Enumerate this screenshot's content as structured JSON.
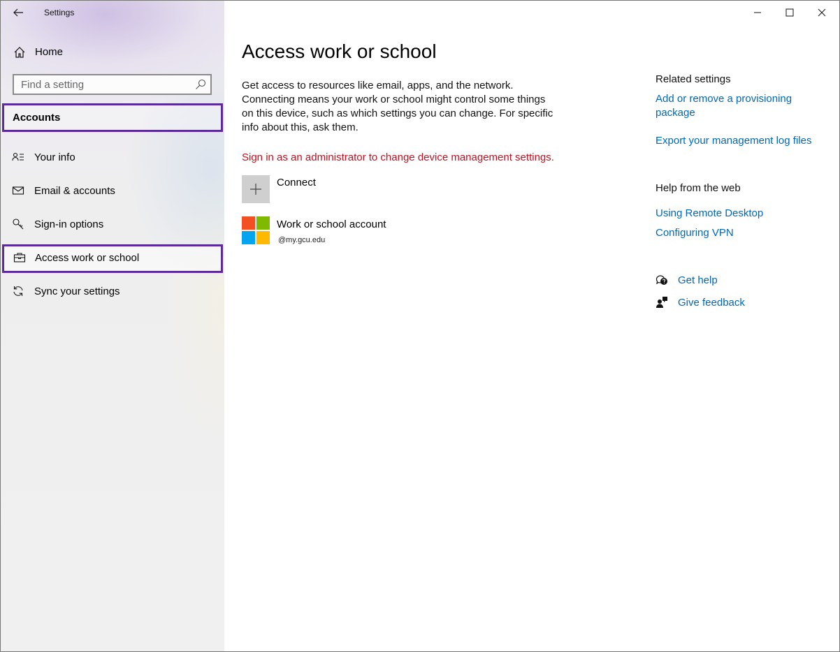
{
  "window": {
    "app_title": "Settings",
    "controls": {
      "minimize": "minimize-icon",
      "maximize": "maximize-icon",
      "close": "close-icon"
    }
  },
  "sidebar": {
    "home_label": "Home",
    "search_placeholder": "Find a setting",
    "section_header": "Accounts",
    "items": [
      {
        "label": "Your info",
        "icon": "person-card-icon"
      },
      {
        "label": "Email & accounts",
        "icon": "mail-icon"
      },
      {
        "label": "Sign-in options",
        "icon": "key-icon"
      },
      {
        "label": "Access work or school",
        "icon": "briefcase-icon",
        "selected": true
      },
      {
        "label": "Sync your settings",
        "icon": "sync-icon"
      }
    ]
  },
  "main": {
    "title": "Access work or school",
    "description": "Get access to resources like email, apps, and the network. Connecting means your work or school might control some things on this device, such as which settings you can change. For specific info about this, ask them.",
    "warning": "Sign in as an administrator to change device management settings.",
    "connect_label": "Connect",
    "account": {
      "name": "Work or school account",
      "email": "@my.gcu.edu"
    }
  },
  "related": {
    "heading": "Related settings",
    "links": [
      "Add or remove a provisioning package",
      "Export your management log files"
    ]
  },
  "help_web": {
    "heading": "Help from the web",
    "links": [
      "Using Remote Desktop",
      "Configuring VPN"
    ]
  },
  "support": {
    "get_help": "Get help",
    "give_feedback": "Give feedback"
  },
  "colors": {
    "accent_link": "#0067b8",
    "warning_text": "#c50f1f",
    "highlight_border": "#5b2a9b",
    "ms_red": "#f25022",
    "ms_green": "#7fba00",
    "ms_blue": "#00a4ef",
    "ms_yellow": "#ffb900"
  }
}
